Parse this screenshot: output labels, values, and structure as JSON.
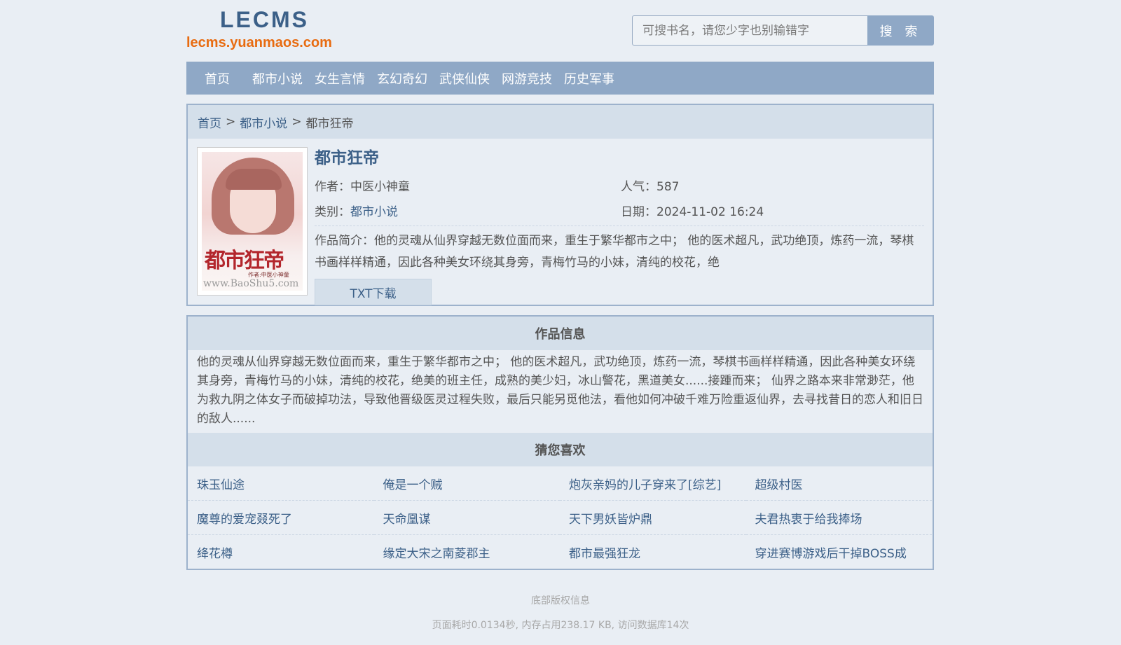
{
  "header": {
    "logo_title": "LECMS",
    "logo_url": "lecms.yuanmaos.com",
    "search_placeholder": "可搜书名，请您少字也别输错字",
    "search_button": "搜 索"
  },
  "nav": {
    "items": [
      "首页",
      "都市小说",
      "女生言情",
      "玄幻奇幻",
      "武侠仙侠",
      "网游竞技",
      "历史军事"
    ]
  },
  "breadcrumb": {
    "home": "首页",
    "category": "都市小说",
    "current": "都市狂帝",
    "separator": ">"
  },
  "book": {
    "cover_title_text": "都市狂帝",
    "cover_subtitle": "作者:中医小神童",
    "cover_site": "www.BaoShu5.com",
    "title": "都市狂帝",
    "author_label": "作者：",
    "author": "中医小神童",
    "popularity_label": "人气：",
    "popularity": "587",
    "category_label": "类别：",
    "category": "都市小说",
    "date_label": "日期：",
    "date": "2024-11-02 16:24",
    "intro_label": "作品简介：",
    "intro": "他的灵魂从仙界穿越无数位面而来，重生于繁华都市之中； 他的医术超凡，武功绝顶，炼药一流，琴棋书画样样精通，因此各种美女环绕其身旁，青梅竹马的小妹，清纯的校花，绝",
    "download_button": "TXT下载"
  },
  "work_info": {
    "heading": "作品信息",
    "description": "他的灵魂从仙界穿越无数位面而来，重生于繁华都市之中； 他的医术超凡，武功绝顶，炼药一流，琴棋书画样样精通，因此各种美女环绕其身旁，青梅竹马的小妹，清纯的校花，绝美的班主任，成熟的美少妇，冰山警花，黑道美女......接踵而来； 仙界之路本来非常渺茫，他为救九阴之体女子而破掉功法，导致他晋级医灵过程失败，最后只能另觅他法，看他如何冲破千难万险重返仙界，去寻找昔日的恋人和旧日的敌人......"
  },
  "recommend": {
    "heading": "猜您喜欢",
    "items": [
      "珠玉仙途",
      "俺是一个贼",
      "炮灰亲妈的儿子穿来了[综艺]",
      "超级村医",
      "魔尊的爱宠叕死了",
      "天命凰谋",
      "天下男妖皆炉鼎",
      "夫君热衷于给我捧场",
      "绛花樽",
      "缘定大宋之南菱郡主",
      "都市最强狂龙",
      "穿进赛博游戏后干掉BOSS成"
    ]
  },
  "footer": {
    "copyright": "底部版权信息",
    "stats": "页面耗时0.0134秒, 内存占用238.17 KB, 访问数据库14次"
  }
}
